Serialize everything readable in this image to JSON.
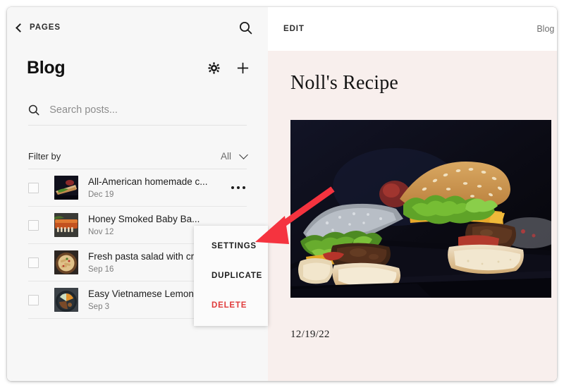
{
  "window": {
    "background": "#ffffff"
  },
  "colors": {
    "panel_bg": "#f7f7f7",
    "editor_bg": "#f8efed",
    "accent_danger": "#e03b3b",
    "annotation_arrow": "#f5333f",
    "text_primary": "#1c1c1c",
    "text_muted": "#7d7d7d",
    "divider": "#e6e6e6"
  },
  "left_panel": {
    "back": {
      "label": "PAGES",
      "icon": "chevron-left-icon"
    },
    "search_icon": "search-icon",
    "title": "Blog",
    "actions": [
      {
        "name": "settings-gear",
        "icon": "gear-icon"
      },
      {
        "name": "add-post",
        "icon": "plus-icon"
      }
    ],
    "search": {
      "icon": "search-icon",
      "value": "",
      "placeholder": "Search posts..."
    },
    "filter": {
      "label": "Filter by",
      "value": "All",
      "icon": "chevron-down-icon",
      "options": [
        "All"
      ]
    },
    "posts": [
      {
        "title": "All-American homemade c...",
        "date": "Dec 19",
        "checked": false,
        "thumb": "sandwich-dark-thumb",
        "menu_open": true
      },
      {
        "title": "Honey Smoked Baby Ba...",
        "date": "Nov 12",
        "checked": false,
        "thumb": "ribs-thumb",
        "menu_open": false
      },
      {
        "title": "Fresh pasta salad with cr...",
        "date": "Sep 16",
        "checked": false,
        "thumb": "pasta-bowl-thumb",
        "menu_open": false
      },
      {
        "title": "Easy Vietnamese Lemongr...",
        "date": "Sep 3",
        "checked": false,
        "thumb": "vietnamese-bowl-thumb",
        "menu_open": false
      }
    ]
  },
  "context_menu": {
    "items": [
      {
        "label": "SETTINGS",
        "danger": false
      },
      {
        "label": "DUPLICATE",
        "danger": false
      },
      {
        "label": "DELETE",
        "danger": true
      }
    ]
  },
  "right_panel": {
    "toolbar": {
      "mode_label": "EDIT",
      "breadcrumb": "Blog ·"
    },
    "article": {
      "title": "Noll's Recipe",
      "hero_image": "burger-sandwich-photo",
      "date": "12/19/22"
    }
  },
  "annotation": {
    "type": "arrow",
    "points_to": "SETTINGS",
    "color": "#f5333f"
  }
}
